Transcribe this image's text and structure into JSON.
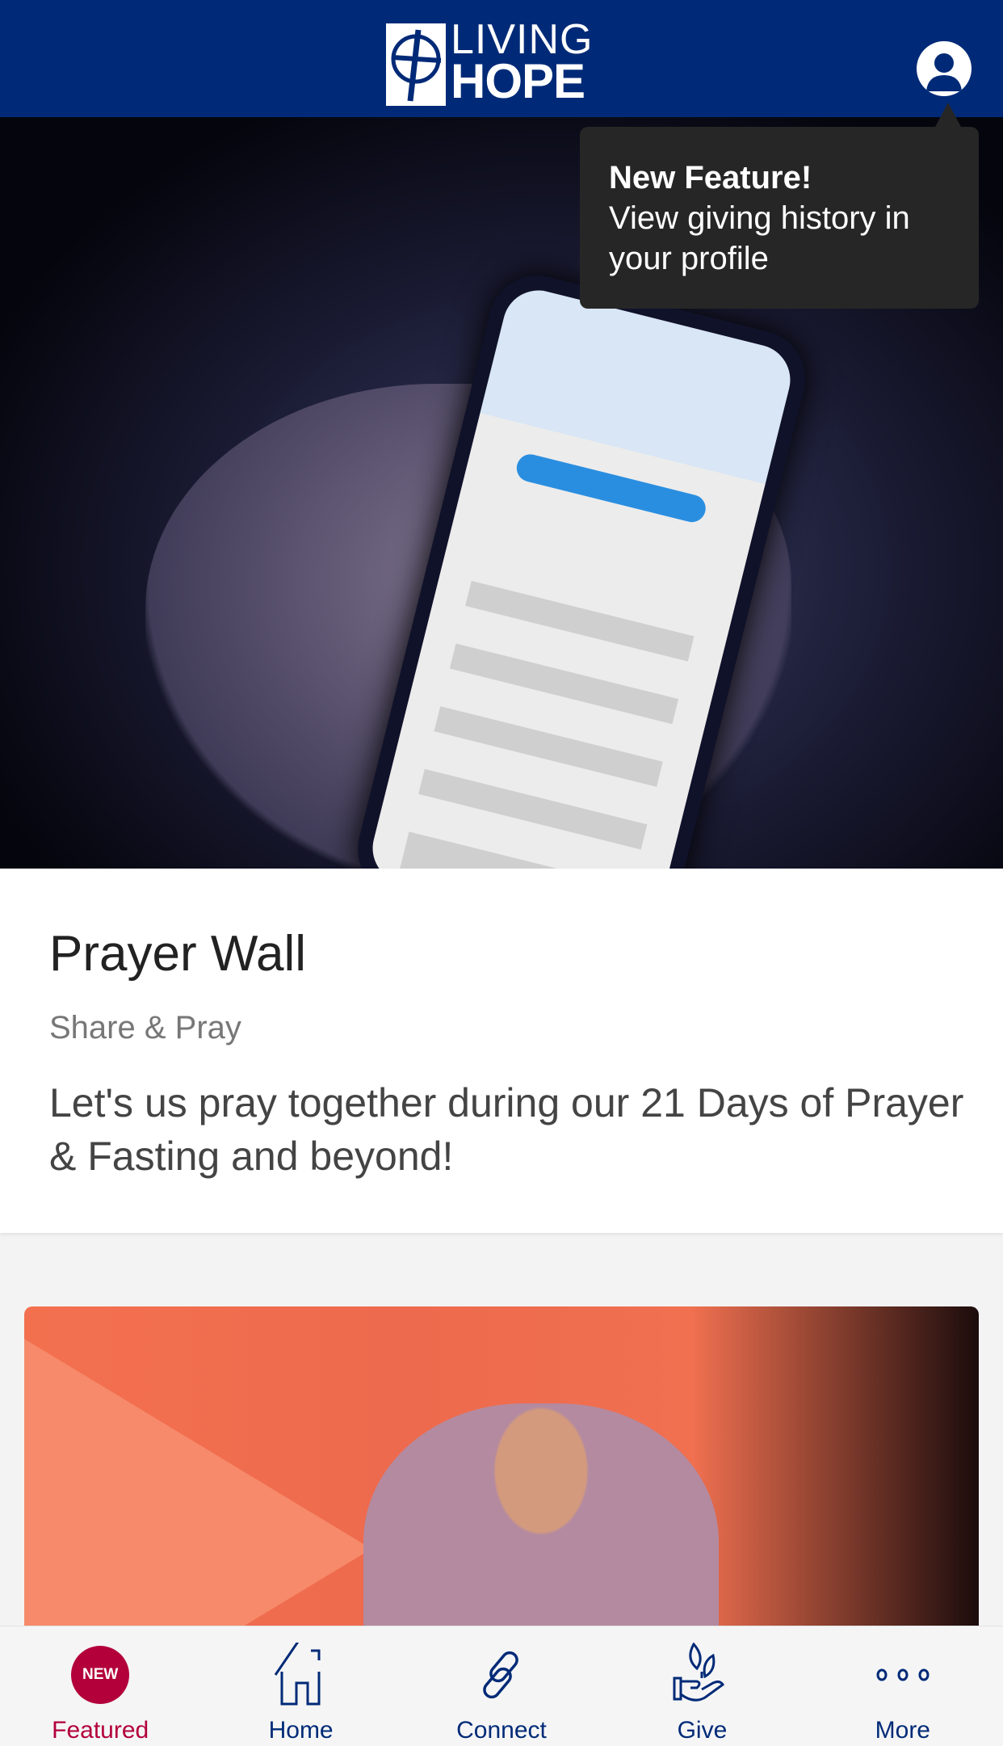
{
  "header": {
    "logo_text_line1": "LIVING",
    "logo_text_line2": "HOPE",
    "profile_icon": "user-circle-icon"
  },
  "tooltip": {
    "title": "New Feature!",
    "body": "View giving history in your profile"
  },
  "feature_card": {
    "title": "Prayer Wall",
    "subtitle": "Share & Pray",
    "description": "Let's us pray together during our 21 Days of Prayer & Fasting and beyond!"
  },
  "bottom_nav": {
    "items": [
      {
        "label": "Featured",
        "badge": "NEW",
        "active": true
      },
      {
        "label": "Home",
        "icon": "home-icon"
      },
      {
        "label": "Connect",
        "icon": "link-icon"
      },
      {
        "label": "Give",
        "icon": "hand-plant-icon"
      },
      {
        "label": "More",
        "icon": "ellipsis-icon"
      }
    ]
  },
  "colors": {
    "brand_navy": "#002a77",
    "accent_red": "#b3003a",
    "tooltip_bg": "#262626"
  }
}
